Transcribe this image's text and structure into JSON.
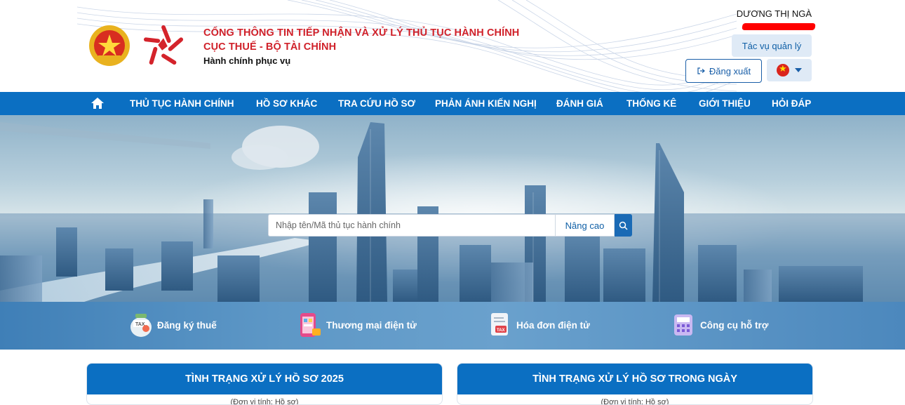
{
  "header": {
    "title_line1": "CỔNG THÔNG TIN TIẾP NHẬN VÀ XỬ LÝ THỦ TỤC HÀNH CHÍNH",
    "title_line2": "CỤC THUẾ - BỘ TÀI CHÍNH",
    "slogan": "Hành chính phục vụ",
    "user_name": "DƯƠNG THỊ NGÀ",
    "admin_button": "Tác vụ quản lý",
    "logout_button": "Đăng xuất",
    "language_flag": "vietnam-flag-icon"
  },
  "nav": {
    "home_icon": "home-icon",
    "items": [
      "THỦ TỤC HÀNH CHÍNH",
      "HỒ SƠ KHÁC",
      "TRA CỨU HỒ SƠ",
      "PHẢN ÁNH KIẾN NGHỊ",
      "ĐÁNH GIÁ",
      "THỐNG KÊ",
      "GIỚI THIỆU",
      "HỎI ĐÁP"
    ]
  },
  "search": {
    "placeholder": "Nhập tên/Mã thủ tục hành chính",
    "advanced_label": "Nâng cao",
    "button_icon": "search-icon"
  },
  "shortcuts": [
    {
      "label": "Đăng ký thuế",
      "icon": "tax-jar-icon"
    },
    {
      "label": "Thương mại điện tử",
      "icon": "ecommerce-phone-icon"
    },
    {
      "label": "Hóa đơn điện tử",
      "icon": "tax-invoice-icon"
    },
    {
      "label": "Công cụ hỗ trợ",
      "icon": "calculator-icon"
    }
  ],
  "panels": [
    {
      "title": "TÌNH TRẠNG XỬ LÝ HỒ SƠ 2025",
      "subtitle": "(Đơn vị tính: Hồ sơ)"
    },
    {
      "title": "TÌNH TRẠNG XỬ LÝ HỒ SƠ TRONG NGÀY",
      "subtitle": "(Đơn vị tính: Hồ sơ)"
    }
  ],
  "colors": {
    "brand_blue": "#0b6fc2",
    "title_red": "#d0212a",
    "button_light": "#dfeaf6"
  }
}
